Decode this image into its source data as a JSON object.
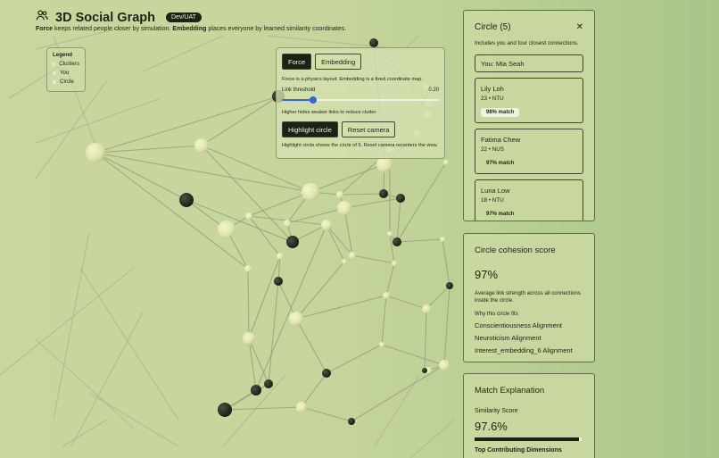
{
  "header": {
    "title": "3D Social Graph",
    "env_badge": "Dev/UAT",
    "subtitle_force": "Force",
    "subtitle_mid": " keeps related people closer by simulation. ",
    "subtitle_embedding": "Embedding",
    "subtitle_end": " places everyone by learned similarity coordinates."
  },
  "legend": {
    "title": "Legend",
    "items": [
      "Clusters",
      "You",
      "Circle"
    ]
  },
  "controls": {
    "mode_force": "Force",
    "mode_embedding": "Embedding",
    "active_mode": "Force",
    "mode_note": "Force is a physics layout. Embedding is a fixed coordinate map.",
    "threshold_label": "Link threshold",
    "threshold_value": "0.20",
    "threshold_fraction": 0.2,
    "threshold_note": "Higher hides weaker links to reduce clutter.",
    "highlight_label": "Highlight circle",
    "reset_label": "Reset camera",
    "action_note": "Highlight circle shows the circle of 5. Reset camera recenters the view."
  },
  "circle_panel": {
    "title": "Circle (5)",
    "subtitle": "Includes you and four closest connections.",
    "you": "You: Mia Seah",
    "people": [
      {
        "name": "Lily Loh",
        "meta": "23 • NTU",
        "match": "98% match"
      },
      {
        "name": "Fatima Chew",
        "meta": "22 • NUS",
        "match": "97% match"
      },
      {
        "name": "Luna Low",
        "meta": "18 • NTU",
        "match": "97% match"
      }
    ]
  },
  "cohesion": {
    "title": "Circle cohesion score",
    "score": "97%",
    "description": "Average link strength across all connections inside the circle.",
    "why_label": "Why this circle fits",
    "reasons": [
      "Conscientiousness Alignment",
      "Neuroticism Alignment",
      "Interest_embedding_6 Alignment"
    ]
  },
  "match": {
    "title": "Match Explanation",
    "similarity_label": "Similarity Score",
    "similarity_value": "97.6%",
    "similarity_fraction": 0.976,
    "dims_label": "Top Contributing Dimensions"
  },
  "colors": {
    "accent": "#2f68d6",
    "ink": "#1c2315",
    "node_light": "#e8ebb5",
    "node_dark": "#1c2315"
  }
}
